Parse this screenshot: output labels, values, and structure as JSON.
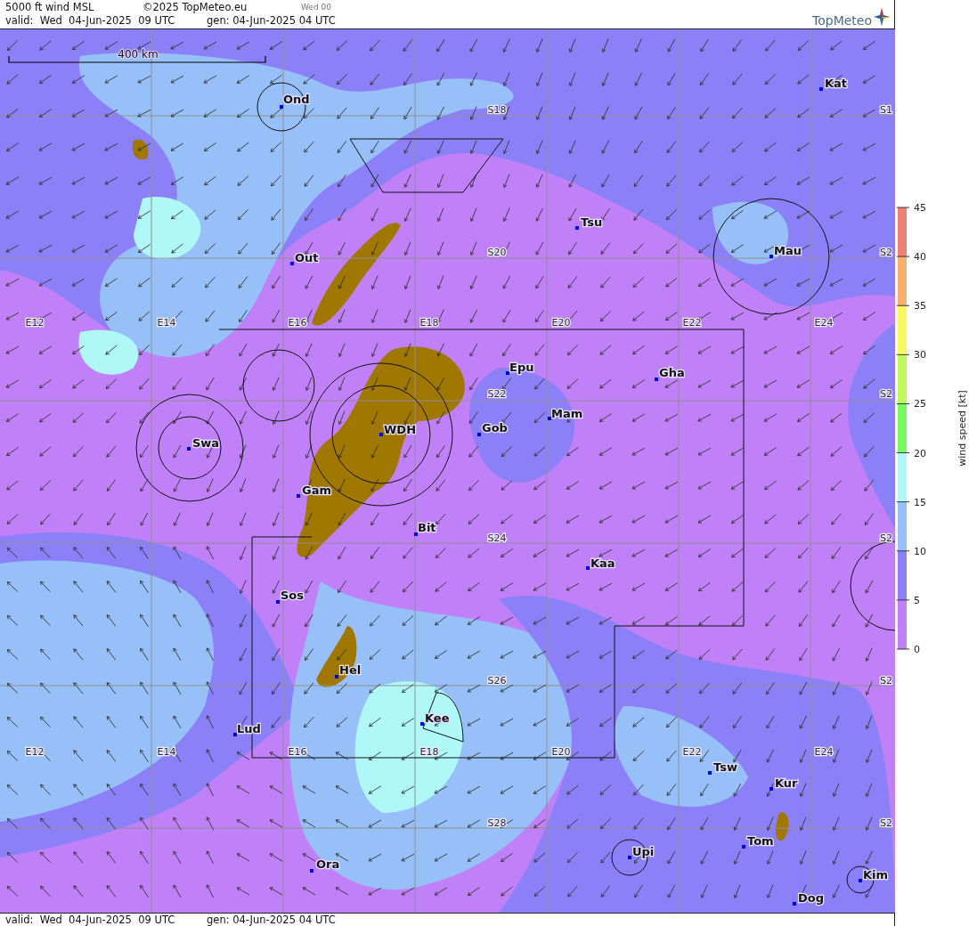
{
  "header": {
    "title": "5000 ft wind MSL",
    "copyright": "©2025 TopMeteo.eu",
    "run": "Wed 00",
    "valid": "valid:  Wed  04-Jun-2025  09 UTC",
    "generated": "gen: 04-Jun-2025 04 UTC",
    "logo": "TopMeteo"
  },
  "map": {
    "scale_label": "400 km",
    "lon_labels_upper": [
      "E12",
      "E14",
      "E16",
      "E18",
      "E20",
      "E22",
      "E24"
    ],
    "lon_labels_lower": [
      "E12",
      "E14",
      "E16",
      "E18",
      "E20",
      "E22",
      "E24"
    ],
    "lat_labels": [
      "S18",
      "S20",
      "S22",
      "S24",
      "S26",
      "S28"
    ],
    "lat_labels_edge": [
      "S1",
      "S2",
      "S2",
      "S2",
      "S2",
      "S2"
    ],
    "places": [
      "Kat",
      "Ond",
      "Tsu",
      "Mau",
      "Out",
      "Epu",
      "Gha",
      "Mam",
      "WDH",
      "Gob",
      "Swa",
      "Gam",
      "Bit",
      "Kaa",
      "Sos",
      "Hel",
      "Kee",
      "Lud",
      "Tsw",
      "Kur",
      "Tom",
      "Upi",
      "Ora",
      "Kim",
      "Dog"
    ]
  },
  "legend": {
    "title": "wind speed [kt]",
    "ticks": [
      "45",
      "40",
      "35",
      "30",
      "25",
      "20",
      "15",
      "10",
      "5",
      "0"
    ],
    "bands": [
      {
        "color": "#f08070"
      },
      {
        "color": "#f8b070"
      },
      {
        "color": "#f8f860"
      },
      {
        "color": "#c0f860"
      },
      {
        "color": "#78f860"
      },
      {
        "color": "#b0f8f8"
      },
      {
        "color": "#98c0f8"
      },
      {
        "color": "#8c80f8"
      },
      {
        "color": "#c080f8"
      }
    ]
  },
  "footer": {
    "valid": "valid:  Wed  04-Jun-2025  09 UTC",
    "generated": "gen: 04-Jun-2025 04 UTC"
  }
}
